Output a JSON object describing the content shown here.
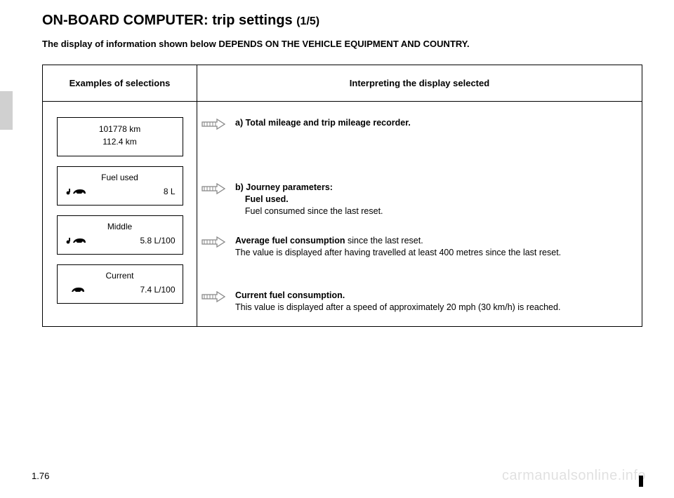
{
  "title_main": "ON-BOARD COMPUTER: trip settings ",
  "title_sub": "(1/5)",
  "note": "The display of information shown below DEPENDS ON THE VEHICLE EQUIPMENT AND COUNTRY.",
  "headers": {
    "left": "Examples of selections",
    "right": "Interpreting the display selected"
  },
  "displays": {
    "d1_line1": "101778 km",
    "d1_line2": "112.4 km",
    "d2_label": "Fuel used",
    "d2_value": "8 L",
    "d3_label": "Middle",
    "d3_value": "5.8 L/100",
    "d4_label": "Current",
    "d4_value": "7.4 L/100"
  },
  "interpret": {
    "a_bold": "a) Total mileage and trip mileage recorder.",
    "b_bold1": "b) Journey parameters:",
    "b_bold2": "Fuel used.",
    "b_plain": "Fuel consumed since the last reset.",
    "c_bold": "Average fuel consumption",
    "c_plain1": " since the last reset.",
    "c_plain2": "The value is displayed after having travelled at least 400 metres since the last reset.",
    "d_bold": "Current fuel consumption.",
    "d_plain": "This value is displayed after a speed of approximately 20 mph (30 km/h) is reached."
  },
  "page_num": "1.76",
  "watermark": "carmanualsonline.info"
}
